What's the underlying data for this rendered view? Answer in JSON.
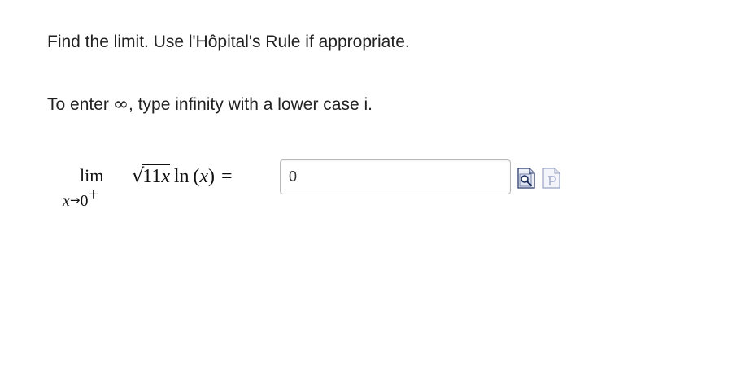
{
  "question": {
    "instruction": "Find the limit. Use l'Hôpital's Rule if appropriate.",
    "hint_before": "To enter ",
    "hint_symbol": "∞",
    "hint_after": ", type infinity with a lower case i."
  },
  "math": {
    "lim": "lim",
    "sub_var": "x",
    "sub_arrow": "→",
    "sub_value": "0",
    "sub_sup": "+",
    "radical_sign": "√",
    "radicand_num": "11",
    "radicand_var": "x",
    "ln": "ln",
    "open_paren": "(",
    "arg_var": "x",
    "close_paren": ")",
    "equals": "="
  },
  "answer_field": {
    "value": "0"
  },
  "icons": {
    "preview": "preview-answer-icon",
    "palette": "math-palette-icon"
  }
}
